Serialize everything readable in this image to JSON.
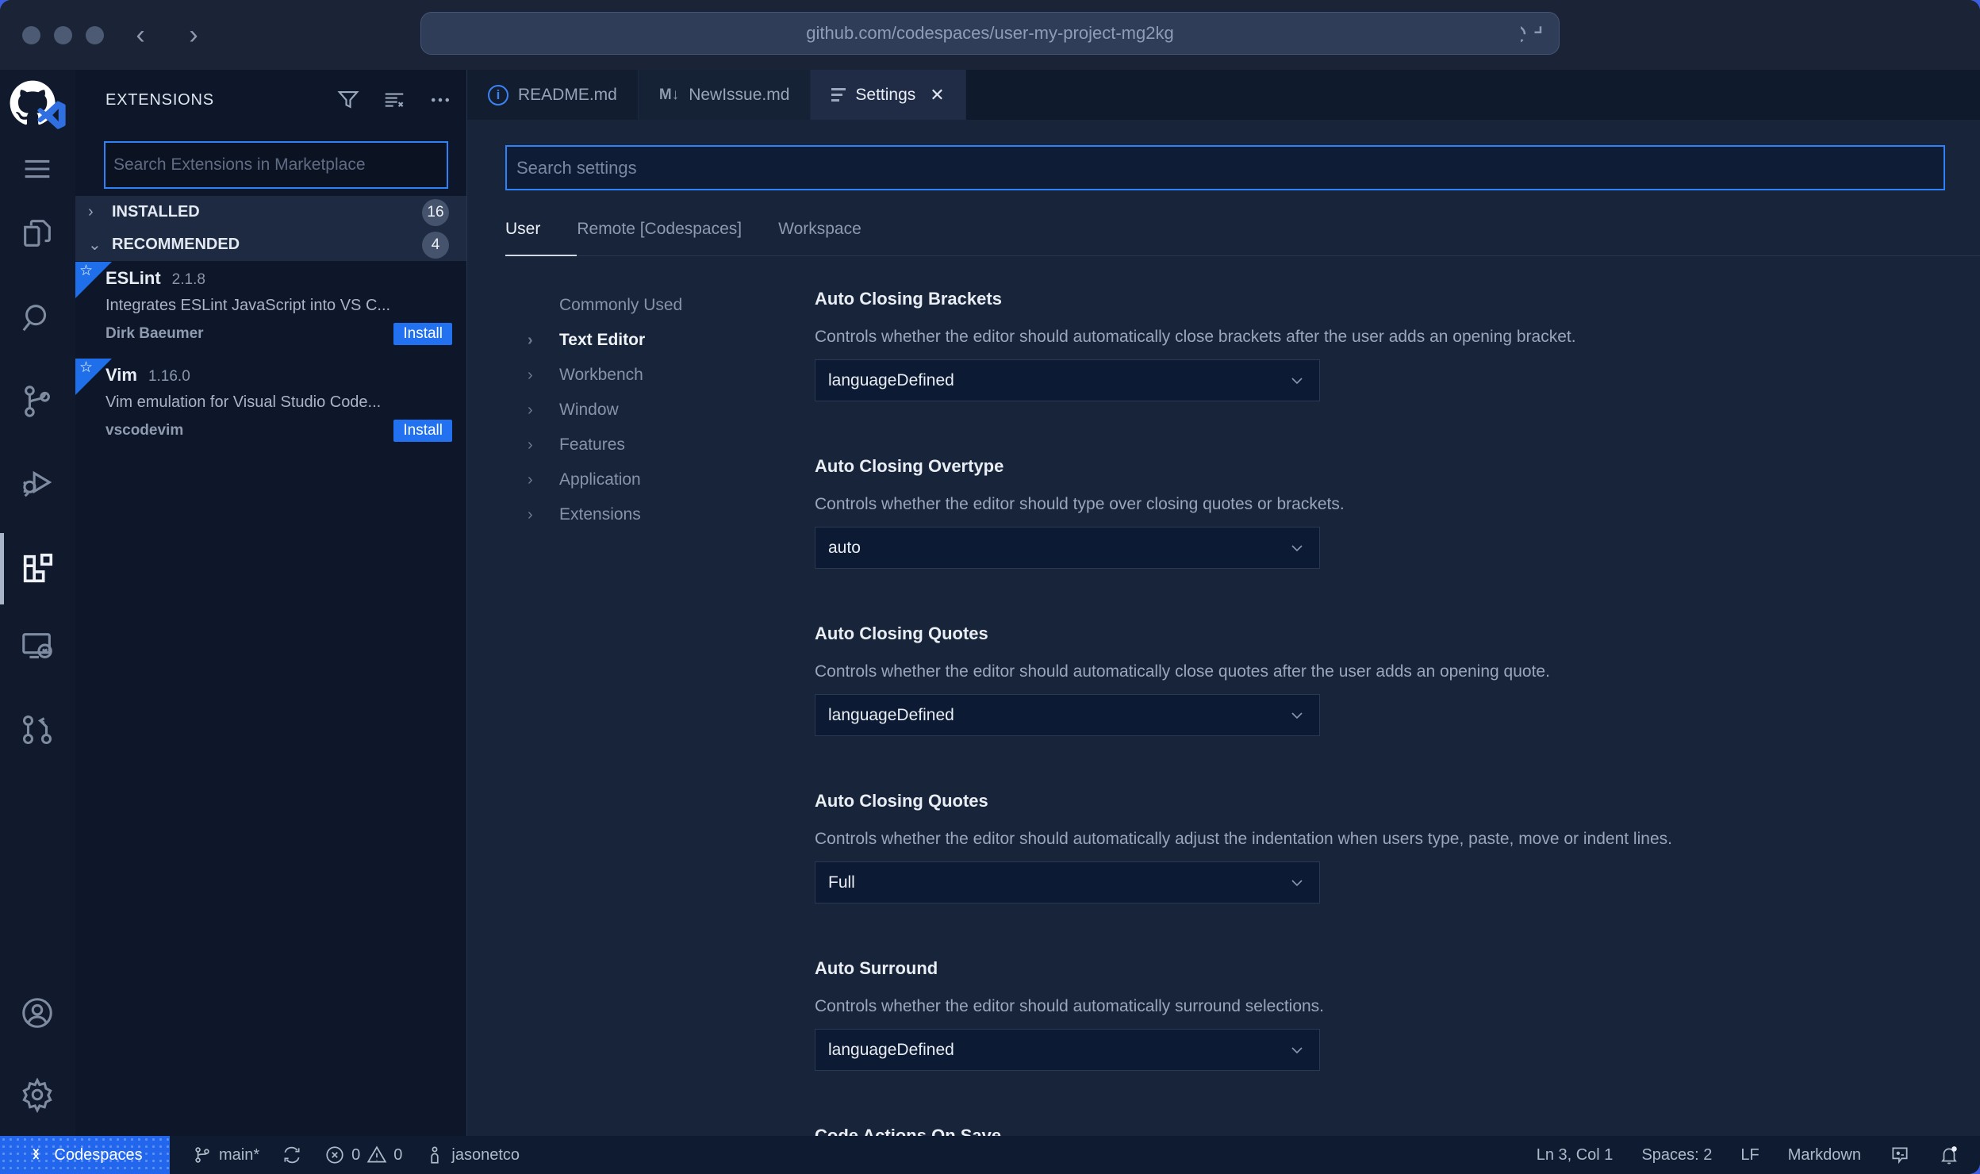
{
  "browser": {
    "url": "github.com/codespaces/user-my-project-mg2kg"
  },
  "sidebar": {
    "title": "EXTENSIONS",
    "search_placeholder": "Search Extensions in Marketplace",
    "sections": [
      {
        "label": "INSTALLED",
        "count": "16"
      },
      {
        "label": "RECOMMENDED",
        "count": "4"
      }
    ],
    "extensions": [
      {
        "name": "ESLint",
        "version": "2.1.8",
        "description": "Integrates ESLint JavaScript into VS C...",
        "publisher": "Dirk Baeumer",
        "action": "Install"
      },
      {
        "name": "Vim",
        "version": "1.16.0",
        "description": "Vim emulation for Visual Studio Code...",
        "publisher": "vscodevim",
        "action": "Install"
      }
    ]
  },
  "tabs": [
    {
      "label": "README.md",
      "icon_text": "i"
    },
    {
      "label": "NewIssue.md",
      "icon_text": "M↓"
    },
    {
      "label": "Settings"
    }
  ],
  "settings": {
    "search_placeholder": "Search settings",
    "scopes": [
      "User",
      "Remote [Codespaces]",
      "Workspace"
    ],
    "toc": [
      "Commonly Used",
      "Text Editor",
      "Workbench",
      "Window",
      "Features",
      "Application",
      "Extensions"
    ],
    "rows": [
      {
        "title": "Auto Closing Brackets",
        "description": "Controls whether the editor should automatically close brackets after the user adds an opening bracket.",
        "value": "languageDefined"
      },
      {
        "title": "Auto Closing Overtype",
        "description": "Controls whether the editor should type over closing quotes or brackets.",
        "value": "auto"
      },
      {
        "title": "Auto Closing Quotes",
        "description": "Controls whether the editor should automatically close quotes after the user adds an opening quote.",
        "value": "languageDefined"
      },
      {
        "title": "Auto Closing Quotes",
        "description": "Controls whether the editor should automatically adjust the indentation when users type, paste, move or indent lines.",
        "value": "Full"
      },
      {
        "title": "Auto Surround",
        "description": "Controls whether the editor should automatically surround selections.",
        "value": "languageDefined"
      }
    ],
    "next_section_title": "Code Actions On Save"
  },
  "status_bar": {
    "codespaces_label": "Codespaces",
    "branch": "main*",
    "errors": "0",
    "warnings": "0",
    "user": "jasonetco",
    "line_col": "Ln 3, Col 1",
    "spaces": "Spaces: 2",
    "eol": "LF",
    "language": "Markdown"
  }
}
